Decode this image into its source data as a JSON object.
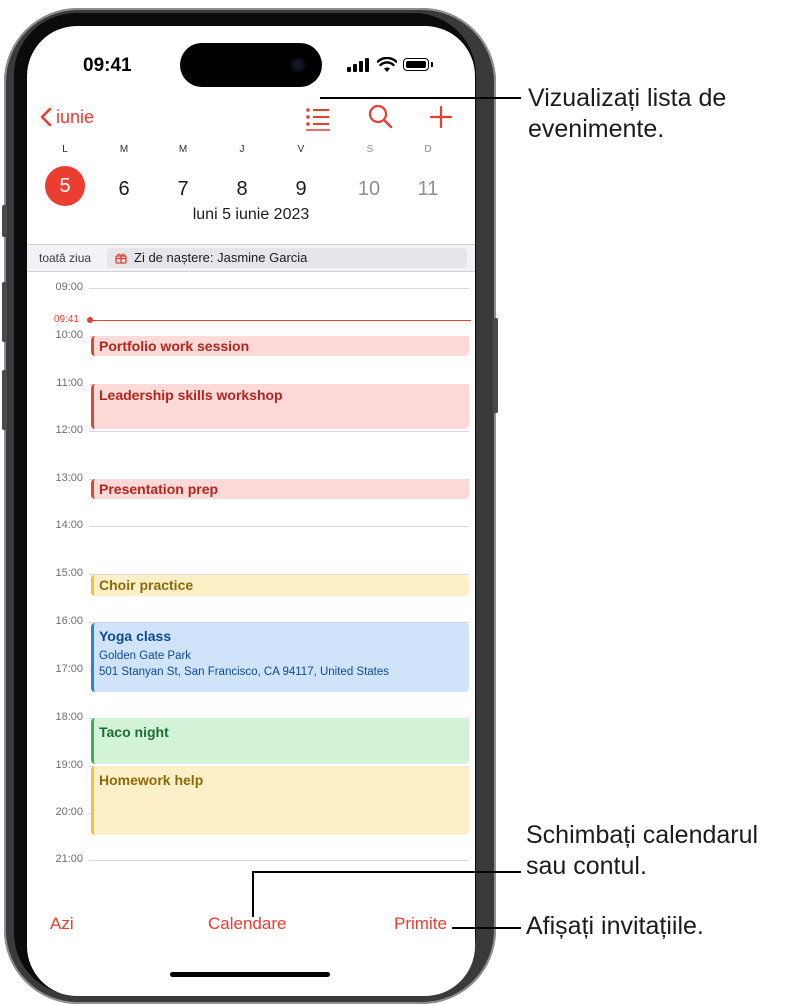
{
  "status_bar": {
    "time": "09:41"
  },
  "nav": {
    "back_label": "iunie"
  },
  "week": {
    "weekdays": [
      "L",
      "M",
      "M",
      "J",
      "V",
      "S",
      "D"
    ],
    "days": [
      "5",
      "6",
      "7",
      "8",
      "9",
      "10",
      "11"
    ],
    "selected_day": "5"
  },
  "date_label": "luni  5 iunie 2023",
  "all_day": {
    "label": "toată ziua",
    "event": "Zi de naștere: Jasmine Garcia"
  },
  "timeline": {
    "hours": [
      "09:00",
      "10:00",
      "11:00",
      "12:00",
      "13:00",
      "14:00",
      "15:00",
      "16:00",
      "17:00",
      "18:00",
      "19:00",
      "20:00",
      "21:00"
    ],
    "now": "09:41"
  },
  "events": [
    {
      "title": "Portfolio work session",
      "color": "#e2463b"
    },
    {
      "title": "Leadership skills workshop",
      "color": "#e2463b"
    },
    {
      "title": "Presentation prep",
      "color": "#e2463b"
    },
    {
      "title": "Choir practice",
      "color": "#f0c33a"
    },
    {
      "title": "Yoga class",
      "location": "Golden Gate Park",
      "address": "501 Stanyan St, San Francisco, CA 94117, United States",
      "color": "#2f7fdc"
    },
    {
      "title": "Taco night",
      "color": "#32b552"
    },
    {
      "title": "Homework help",
      "color": "#f0c33a"
    }
  ],
  "toolbar": {
    "today": "Azi",
    "calendars": "Calendare",
    "inbox": "Primite"
  },
  "callouts": {
    "list_view": [
      "Vizualizați lista de",
      "evenimente."
    ],
    "calendars": [
      "Schimbați calendarul",
      "sau contul."
    ],
    "inbox": "Afișați invitațiile."
  },
  "colors": {
    "accent": "#eb3d30"
  },
  "icons": [
    "chevron-left-icon",
    "list-icon",
    "search-icon",
    "plus-icon",
    "gift-icon",
    "signal-icon",
    "wifi-icon",
    "battery-icon"
  ]
}
